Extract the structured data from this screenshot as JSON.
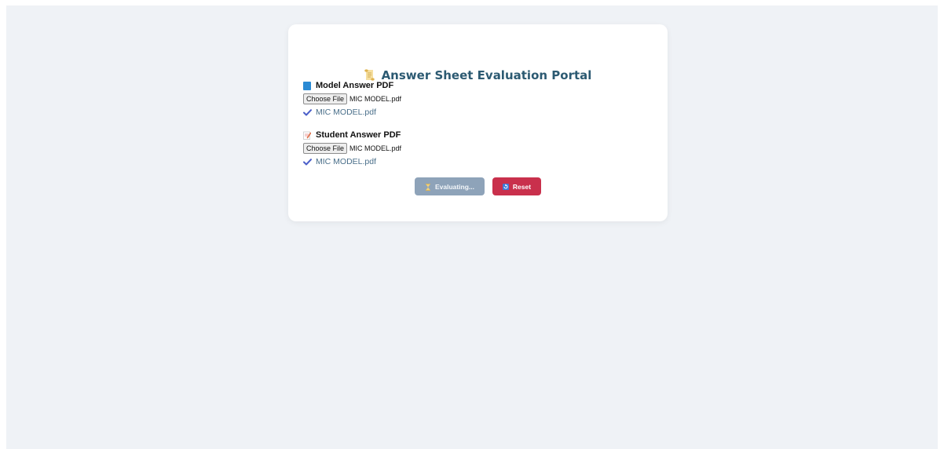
{
  "portal": {
    "title": "Answer Sheet Evaluation Portal",
    "title_icon": "scroll-icon"
  },
  "model_section": {
    "label": "Model Answer PDF",
    "icon": "blue-book-icon",
    "choose_button": "Choose File",
    "file_name": "MIC MODEL.pdf",
    "selected_text": "MIC MODEL.pdf"
  },
  "student_section": {
    "label": "Student Answer PDF",
    "icon": "memo-icon",
    "choose_button": "Choose File",
    "file_name": "MIC MODEL.pdf",
    "selected_text": "MIC MODEL.pdf"
  },
  "actions": {
    "evaluate_label": "Evaluating...",
    "evaluate_icon": "hourglass-icon",
    "reset_label": "Reset",
    "reset_icon": "reset-icon"
  },
  "colors": {
    "page_background": "#eff2f6",
    "card_background": "#ffffff",
    "title_color": "#2c5a72",
    "evaluate_button": "#8ea3b9",
    "reset_button": "#c9304c",
    "check_color": "#4b5fc9"
  }
}
